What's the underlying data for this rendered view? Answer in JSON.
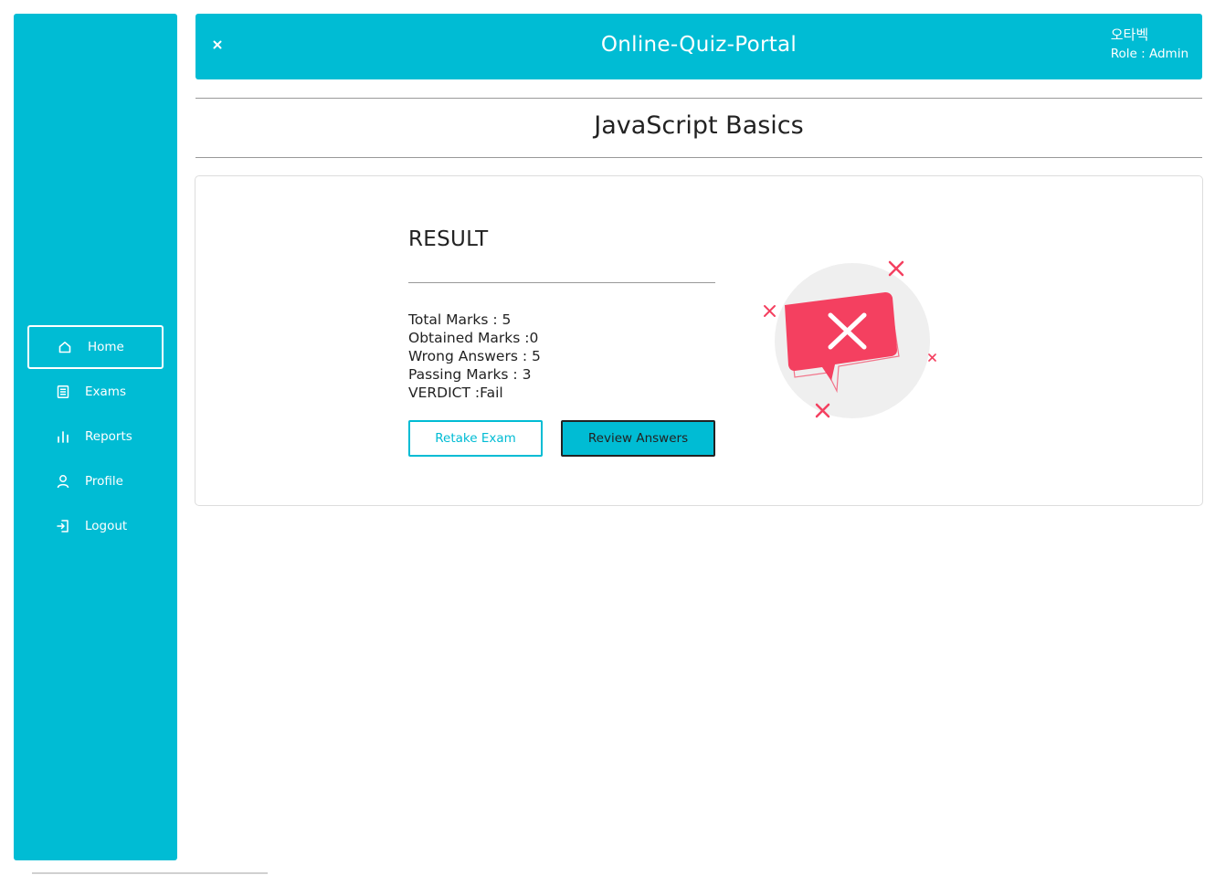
{
  "app": {
    "title": "Online-Quiz-Portal",
    "user_name": "오타벡",
    "user_role": "Role : Admin"
  },
  "sidebar": {
    "items": [
      {
        "label": "Home",
        "icon": "home-icon",
        "active": true
      },
      {
        "label": "Exams",
        "icon": "document-icon",
        "active": false
      },
      {
        "label": "Reports",
        "icon": "bar-chart-icon",
        "active": false
      },
      {
        "label": "Profile",
        "icon": "user-icon",
        "active": false
      },
      {
        "label": "Logout",
        "icon": "logout-icon",
        "active": false
      }
    ]
  },
  "exam": {
    "title": "JavaScript Basics"
  },
  "result": {
    "heading": "RESULT",
    "total_marks": "Total Marks : 5",
    "obtained_marks": "Obtained Marks :0",
    "wrong_answers": "Wrong Answers : 5",
    "passing_marks": "Passing Marks : 3",
    "verdict": "VERDICT :Fail",
    "retake_label": "Retake Exam",
    "review_label": "Review Answers",
    "illustration_icon": "fail-message-icon"
  },
  "colors": {
    "accent": "#00bcd4",
    "fail": "#f44060",
    "text": "#222222"
  }
}
